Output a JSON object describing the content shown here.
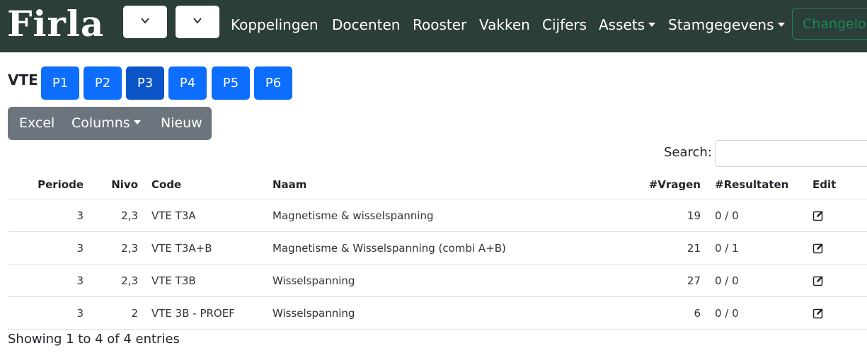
{
  "nav": {
    "logo": "Firla",
    "items": [
      "Koppelingen",
      "Docenten",
      "Rooster",
      "Vakken",
      "Cijfers"
    ],
    "assets": "Assets",
    "stamgegevens": "Stamgegevens",
    "changelog": "Changelog"
  },
  "subject": {
    "label": "VTE",
    "periods": [
      "P1",
      "P2",
      "P3",
      "P4",
      "P5",
      "P6"
    ],
    "active_period": "P3"
  },
  "toolbar": {
    "excel": "Excel",
    "columns": "Columns",
    "nieuw": "Nieuw"
  },
  "search": {
    "label": "Search:",
    "value": ""
  },
  "table": {
    "headers": [
      "Periode",
      "Nivo",
      "Code",
      "Naam",
      "#Vragen",
      "#Resultaten",
      "Edit"
    ],
    "rows": [
      [
        "3",
        "2,3",
        "VTE T3A",
        "Magnetisme & wisselspanning",
        "19",
        "0 / 0"
      ],
      [
        "3",
        "2,3",
        "VTE T3A+B",
        "Magnetisme & Wisselspanning (combi A+B)",
        "21",
        "0 / 1"
      ],
      [
        "3",
        "2,3",
        "VTE T3B",
        "Wisselspanning",
        "27",
        "0 / 0"
      ],
      [
        "3",
        "2",
        "VTE 3B - PROEF",
        "Wisselspanning",
        "6",
        "0 / 0"
      ]
    ]
  },
  "info": "Showing 1 to 4 of 4 entries",
  "colors": {
    "navbar": "#2c3e38",
    "primary": "#0d6efd",
    "primary_active": "#0b55c8",
    "secondary": "#6c757d",
    "success": "#198754"
  }
}
